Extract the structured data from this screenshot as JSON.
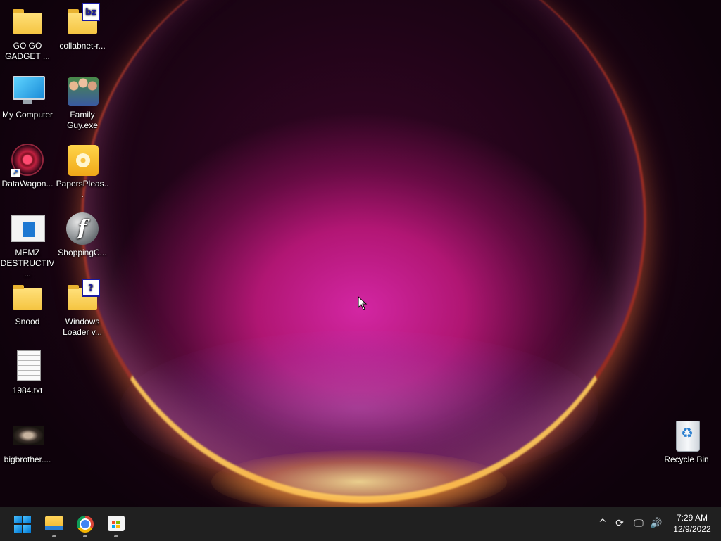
{
  "desktop": {
    "icons": [
      {
        "label": "GO GO GADGET ...",
        "icon": "folder-icon"
      },
      {
        "label": "collabnet-r...",
        "icon": "archive-folder-icon",
        "badge": "bz"
      },
      {
        "label": "My Computer",
        "icon": "monitor-icon"
      },
      {
        "label": "Family Guy.exe",
        "icon": "family-guy-icon"
      },
      {
        "label": "DataWagon...",
        "icon": "datawagon-icon"
      },
      {
        "label": "PapersPleas...",
        "icon": "disc-icon"
      },
      {
        "label": "MEMZ DESTRUCTIV...",
        "icon": "window-app-icon"
      },
      {
        "label": "ShoppingC...",
        "icon": "flash-icon"
      },
      {
        "label": "Snood",
        "icon": "folder-icon"
      },
      {
        "label": "Windows Loader v...",
        "icon": "help-folder-icon",
        "badge": "?"
      },
      {
        "label": "1984.txt",
        "icon": "text-file-icon"
      },
      {
        "label": "bigbrother....",
        "icon": "image-file-icon"
      },
      {
        "label": "Recycle Bin",
        "icon": "recycle-bin-icon"
      }
    ]
  },
  "taskbar": {
    "pinned": [
      {
        "name": "start-button",
        "icon": "windows-logo-icon"
      },
      {
        "name": "file-explorer-button",
        "icon": "file-explorer-icon"
      },
      {
        "name": "chrome-button",
        "icon": "chrome-icon"
      },
      {
        "name": "microsoft-store-button",
        "icon": "store-icon"
      }
    ],
    "tray": {
      "chevron": "^",
      "sync_glyph": "⟳",
      "network_glyph": "🖵",
      "volume_glyph": "🔊"
    },
    "clock": {
      "time": "7:29 AM",
      "date": "12/9/2022"
    }
  },
  "colors": {
    "taskbar_bg": "#202020",
    "accent": "#0078d4"
  }
}
